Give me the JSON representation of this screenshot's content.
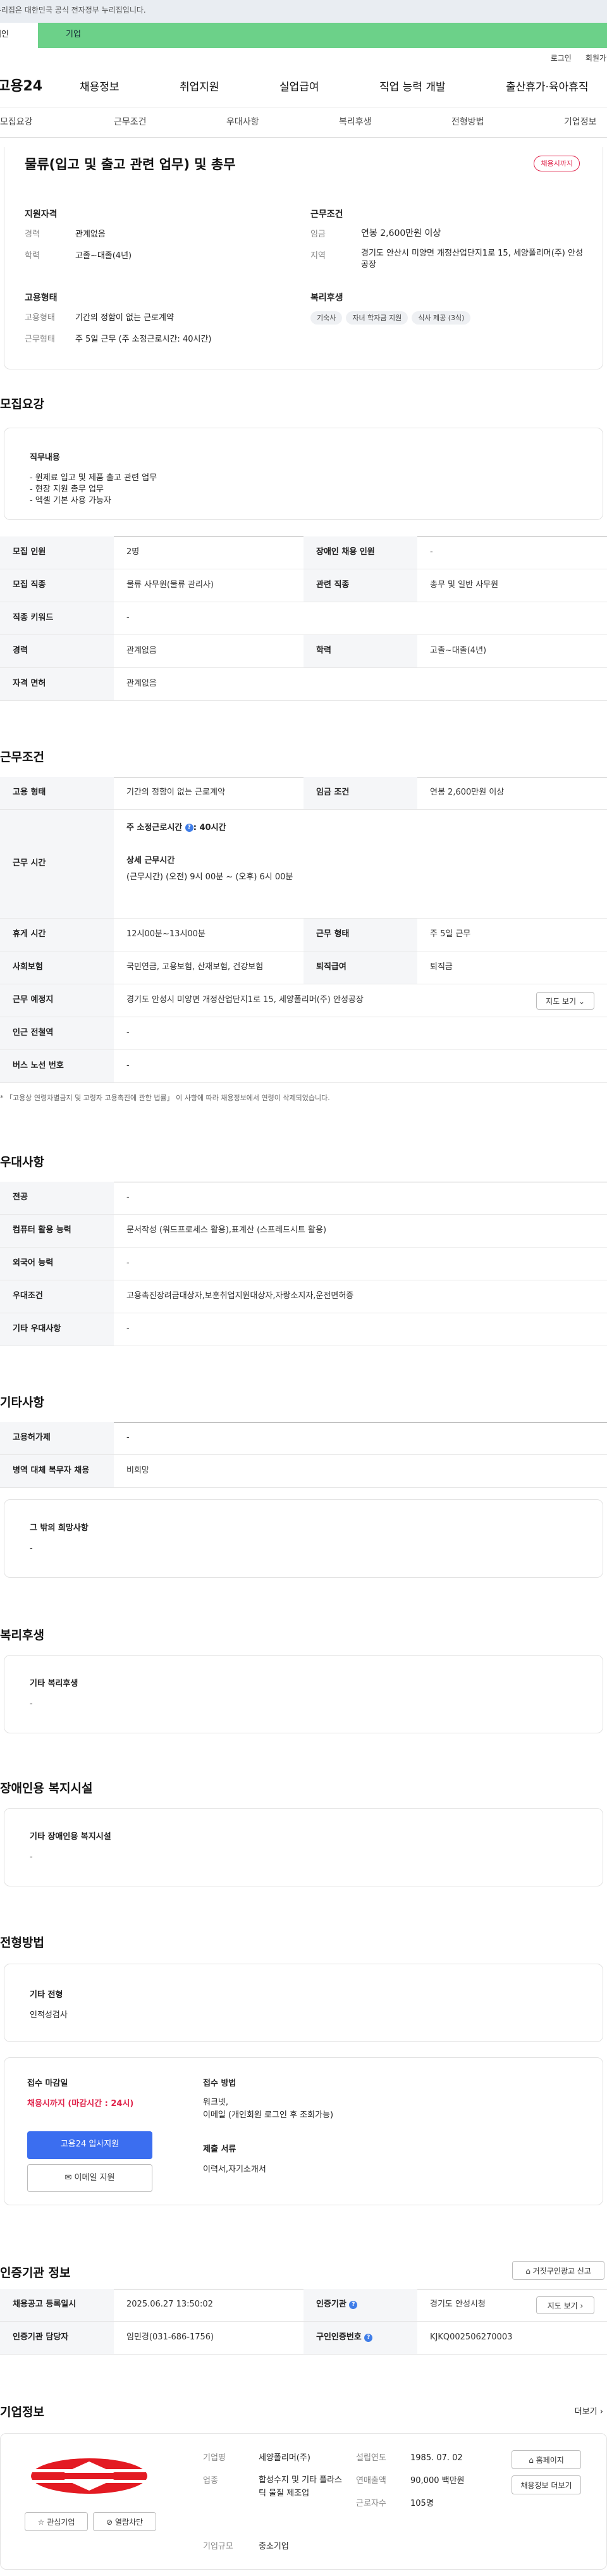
{
  "gov_banner": "이 누리집은 대한민국 공식 전자정부 누리집입니다.",
  "user_tabs": {
    "individual": "개인",
    "enterprise": "기업"
  },
  "util": {
    "login": "로그인",
    "join": "회원가입"
  },
  "logo": "고용24",
  "gnb": [
    "채용정보",
    "취업지원",
    "실업급여",
    "직업 능력 개발",
    "출산휴가·육아휴직"
  ],
  "subnav": [
    "모집요강",
    "근무조건",
    "우대사항",
    "복리후생",
    "전형방법",
    "기업정보"
  ],
  "summary": {
    "title": "물류(입고 및 출고 관련 업무) 및 총무",
    "badge": "채용시까지",
    "qual_title": "지원자격",
    "career_label": "경력",
    "career": "관계없음",
    "edu_label": "학력",
    "edu": "고졸~대졸(4년)",
    "cond_title": "근무조건",
    "wage_label": "임금",
    "wage": "연봉 2,600만원 이상",
    "area_label": "지역",
    "area": "경기도 안산시 미양면 개정산업단지1로 15, 세양폴리머(주) 안성공장",
    "form_title": "고용형태",
    "form_label": "고용형태",
    "form": "기간의 정함이 없는 근로계약",
    "shift_label": "근무형태",
    "shift": "주 5일 근무 (주 소정근로시간: 40시간)",
    "welfare_title": "복리후생",
    "welfare": [
      "기숙사",
      "자녀 학자금 지원",
      "식사 제공 (3식)"
    ]
  },
  "recruit": {
    "heading": "모집요강",
    "job_title": "직무내용",
    "job_lines": [
      "- 원제료 입고 및 제품 출고 관련 업무",
      "- 현장 지원 총무 업무",
      "- 엑셀 기본 사용 가능자"
    ],
    "rows": [
      [
        "모집 인원",
        "2명",
        "장애인 채용 인원",
        "-"
      ],
      [
        "모집 직종",
        "물류 사무원(물류 관리사)",
        "관련 직종",
        "총무 및 일반 사무원"
      ],
      [
        "직종 키워드",
        "-"
      ],
      [
        "경력",
        "관계없음",
        "학력",
        "고졸~대졸(4년)"
      ],
      [
        "자격 면허",
        "관계없음"
      ]
    ]
  },
  "work": {
    "heading": "근무조건",
    "form_label": "고용 형태",
    "form": "기간의 정함이 없는 근로계약",
    "wage_label": "임금 조건",
    "wage": "연봉 2,600만원 이상",
    "hours_label": "근무 시간",
    "hours_week": "주 소정근로시간",
    "hours_week_val": ": 40시간",
    "hours_detail_title": "상세 근무시간",
    "hours_detail": "(근무시간) (오전) 9시 00분 ~ (오후) 6시 00분",
    "rest_label": "휴게 시간",
    "rest": "12시00분~13시00분",
    "shift_label": "근무 형태",
    "shift": "주 5일 근무",
    "ins_label": "사회보험",
    "ins": "국민연금, 고용보험, 산재보험, 건강보험",
    "retire_label": "퇴직급여",
    "retire": "퇴직금",
    "place_label": "근무 예정지",
    "place": "경기도 안성시 미양면 개정산업단지1로 15, 세양폴리머(주) 안성공장",
    "map_btn": "지도 보기",
    "subway_label": "인근 전철역",
    "subway": "-",
    "bus_label": "버스 노선 번호",
    "bus": "-",
    "note": "* 「고용상 연령차별금지 및 고령자 고용촉진에 관한 법률」 이 사항에 따라 채용정보에서 연령이 삭제되었습니다."
  },
  "pref": {
    "heading": "우대사항",
    "rows": [
      [
        "전공",
        "-"
      ],
      [
        "컴퓨터 활용 능력",
        "문서작성 (워드프로세스 활용),표계산 (스프레드시트 활용)"
      ],
      [
        "외국어 능력",
        "-"
      ],
      [
        "우대조건",
        "고용촉진장려금대상자,보훈취업지원대상자,자랑소지자,운전면허증"
      ],
      [
        "기타 우대사항",
        "-"
      ]
    ]
  },
  "etc": {
    "heading": "기타사항",
    "rows": [
      [
        "고용허가제",
        "-"
      ],
      [
        "병역 대체 복무자 채용",
        "비희망"
      ]
    ],
    "box_title": "그 밖의 희망사항",
    "box_val": "-"
  },
  "welfare": {
    "heading": "복리후생",
    "box_title": "기타 복리후생",
    "box_val": "-"
  },
  "disabled": {
    "heading": "장애인용 복지시설",
    "box_title": "기타 장애인용 복지시설",
    "box_val": "-"
  },
  "process": {
    "heading": "전형방법",
    "etc_title": "기타 전형",
    "etc_val": "인적성검사",
    "deadline_title": "접수 마감일",
    "deadline_val": "채용시까지 (마감시간 : 24시)",
    "apply_btn": "고용24 입사지원",
    "email_btn": "이메일 지원",
    "method_title": "접수 방법",
    "method_lines": [
      "워크넷,",
      "이메일 (개인회원 로그인 후 조회가능)"
    ],
    "docs_title": "제출 서류",
    "docs_val": "이력서,자기소개서"
  },
  "cert": {
    "heading": "인증기관 정보",
    "report_btn": "거짓구인광고 신고",
    "rows": [
      [
        "채용공고 등록일시",
        "2025.06.27 13:50:02",
        "인증기관",
        "경기도 안성시청"
      ],
      [
        "인증기관 담당자",
        "임민경(031-686-1756)",
        "구인인증번호",
        "KJKQ002506270003"
      ]
    ],
    "map_btn": "지도 보기"
  },
  "company": {
    "heading": "기업정보",
    "more": "더보기",
    "fav_btn": "관심기업",
    "block_btn": "열람차단",
    "name_label": "기업명",
    "name": "세양폴리머(주)",
    "est_label": "설립연도",
    "est": "1985. 07. 02",
    "biz_label": "업종",
    "biz": "합성수지 및 기타 플라스틱 물질 제조업",
    "sales_label": "연매출액",
    "sales": "90,000 백만원",
    "emp_label": "근로자수",
    "emp": "105명",
    "scale_label": "기업규모",
    "scale": "중소기업",
    "home_btn": "홈페이지",
    "jobs_btn": "채용정보 더보기"
  },
  "colors": {
    "accent": "#3b6ef0",
    "green": "#6cd189",
    "red": "#e0244b"
  }
}
